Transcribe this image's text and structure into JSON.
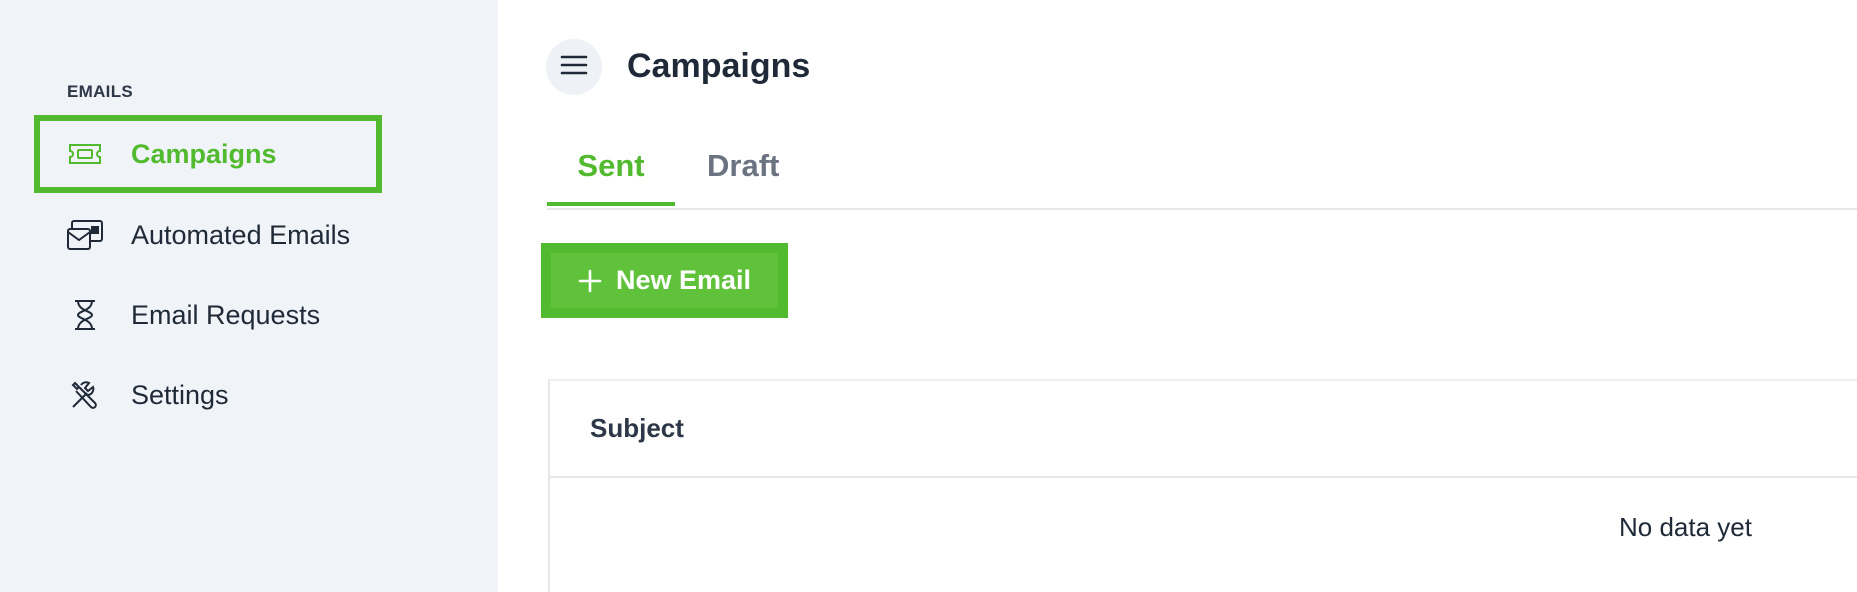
{
  "sidebar": {
    "section_label": "EMAILS",
    "items": [
      {
        "label": "Campaigns",
        "icon": "ticket-icon",
        "active": true
      },
      {
        "label": "Automated Emails",
        "icon": "mail-stack-icon",
        "active": false
      },
      {
        "label": "Email Requests",
        "icon": "hourglass-icon",
        "active": false
      },
      {
        "label": "Settings",
        "icon": "tools-icon",
        "active": false
      }
    ]
  },
  "header": {
    "menu_icon": "hamburger-icon",
    "title": "Campaigns"
  },
  "tabs": [
    {
      "label": "Sent",
      "active": true
    },
    {
      "label": "Draft",
      "active": false
    }
  ],
  "actions": {
    "new_email_label": "New Email",
    "new_email_icon": "plus-icon"
  },
  "table": {
    "columns": [
      "Subject"
    ],
    "empty_text": "No data yet"
  },
  "colors": {
    "accent": "#52ba2f",
    "sidebar_bg": "#f0f3f7",
    "text": "#1f2937",
    "muted": "#6b7280"
  }
}
